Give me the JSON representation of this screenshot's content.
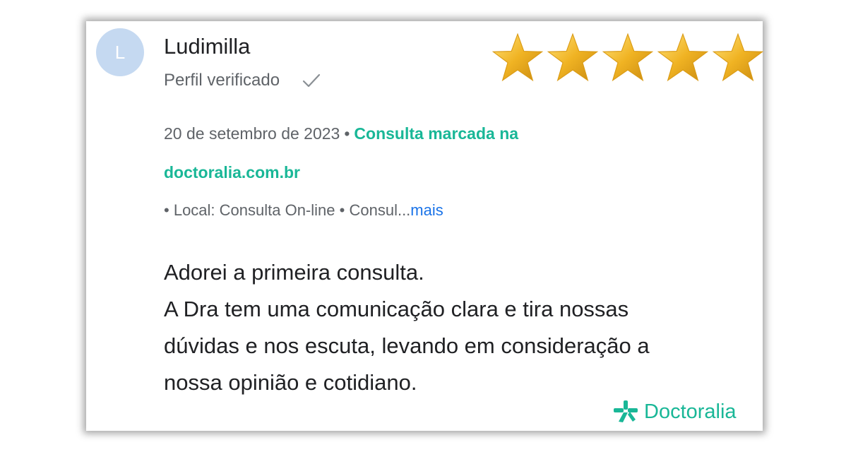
{
  "review": {
    "avatar_letter": "L",
    "author": "Ludimilla",
    "verified_label": "Perfil verificado",
    "rating_stars": 5,
    "rating_max": 5,
    "date": "20 de setembro de 2023",
    "booking_text_1": "Consulta marcada na",
    "booking_text_2": "doctoralia.com.br",
    "bullet": "•",
    "location": "Local: Consulta On-line",
    "truncated": "Consul...",
    "more_label": "mais",
    "body_lines": [
      "Adorei a primeira consulta.",
      "A Dra tem uma comunicação clara e tira nossas",
      "dúvidas e nos escuta, levando em consideração a",
      "nossa opinião e cotidiano."
    ]
  },
  "brand": {
    "name": "Doctoralia",
    "color": "#19b797"
  },
  "colors": {
    "star": "#f0b323",
    "link": "#1a73e8",
    "accent": "#19b797",
    "avatar_bg": "#c5d9f1"
  },
  "icons": {
    "check": "check-icon",
    "star": "star-icon",
    "logo": "doctoralia-logo-icon"
  }
}
